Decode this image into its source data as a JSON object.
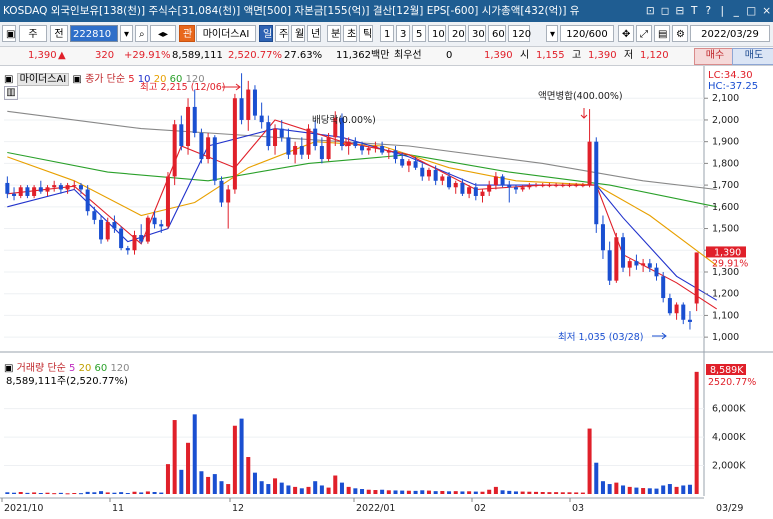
{
  "window": {
    "title": "KOSDAQ 외국인보유[138(천)] 주식수[31,084(천)] 액면[500] 자본금[155(억)] 결산[12월] EPS[-600] 시가총액[432(억)] 유",
    "controls": [
      "⊡",
      "◻",
      "⊟",
      "T",
      "?",
      "|",
      "_",
      "□",
      "×"
    ]
  },
  "toolbar": {
    "market": "주",
    "scope": "전",
    "code": "222810",
    "tag_gwan": "관",
    "stock_name": "마이더스AI",
    "period_tabs": [
      "일",
      "주",
      "월",
      "년",
      "분",
      "초",
      "틱"
    ],
    "active_period": "일",
    "minute_options": [
      "1",
      "3",
      "5",
      "10",
      "20",
      "30",
      "60",
      "120"
    ],
    "count": "120/600",
    "date": "2022/03/29"
  },
  "pricebar": {
    "price": "1,390",
    "change": "320",
    "change_pct": "+29.91%",
    "volume": "8,589,111",
    "vol_ratio": "2,520.77%",
    "turnover": "27.63%",
    "amount": "11,362백만",
    "label_pref": "최우선",
    "pref_value": "0",
    "pref_price": "1,390",
    "open_label": "시",
    "open": "1,155",
    "high_label": "고",
    "high": "1,390",
    "low_label": "저",
    "low": "1,120",
    "buy_label": "매수",
    "sell_label": "매도"
  },
  "price_panel": {
    "legend_name": "마이더스AI",
    "legend_ma": "종가 단순",
    "ma_periods": [
      "5",
      "10",
      "20",
      "60",
      "120"
    ],
    "ma_colors": [
      "#e0202a",
      "#2233cc",
      "#e8a000",
      "#2aa02a",
      "#888888"
    ],
    "lc_label": "LC:34.30",
    "hc_label": "HC:-37.25",
    "annotations": {
      "high_label": "최고 2,215 (12/06)",
      "dividend_label": "배당락(0.00%)",
      "split_label": "액면병합(400.00%)",
      "low_label": "최저 1,035 (03/28)"
    },
    "last_price_tag": "1,390",
    "last_pct_tag": "29.91%",
    "y_ticks": [
      "2,100",
      "2,000",
      "1,900",
      "1,800",
      "1,700",
      "1,600",
      "1,500",
      "1,400",
      "1,300",
      "1,200",
      "1,100",
      "1,000"
    ]
  },
  "volume_panel": {
    "legend_name": "거래량",
    "legend_ma": "단순",
    "ma_periods": [
      "5",
      "20",
      "60",
      "120"
    ],
    "value_text": "8,589,111주(2,520.77%)",
    "tag_value": "8,589K",
    "tag_pct": "2520.77%",
    "y_ticks": [
      "6,000K",
      "4,000K",
      "2,000K"
    ]
  },
  "x_axis": {
    "labels": [
      "2021/10",
      "11",
      "12",
      "2022/01",
      "02",
      "03",
      "03/29"
    ]
  },
  "colors": {
    "up": "#e0202a",
    "down": "#1a4fd1",
    "titlebar": "#1f5d92",
    "ma5": "#e0202a",
    "ma10": "#2233cc",
    "ma20": "#e8a000",
    "ma60": "#2aa02a",
    "ma120": "#888888"
  },
  "chart_data": {
    "type": "candlestick",
    "price_range": [
      950,
      2230
    ],
    "volume_range": [
      0,
      9000
    ],
    "volume_unit": "K",
    "candles": [
      [
        1710,
        1740,
        1640,
        1660
      ],
      [
        1660,
        1690,
        1630,
        1650
      ],
      [
        1650,
        1700,
        1640,
        1690
      ],
      [
        1690,
        1700,
        1640,
        1650
      ],
      [
        1650,
        1700,
        1640,
        1690
      ],
      [
        1690,
        1720,
        1660,
        1670
      ],
      [
        1670,
        1700,
        1650,
        1690
      ],
      [
        1690,
        1720,
        1670,
        1700
      ],
      [
        1700,
        1710,
        1660,
        1680
      ],
      [
        1680,
        1710,
        1660,
        1700
      ],
      [
        1700,
        1720,
        1680,
        1700
      ],
      [
        1700,
        1710,
        1660,
        1680
      ],
      [
        1680,
        1700,
        1560,
        1580
      ],
      [
        1580,
        1600,
        1520,
        1540
      ],
      [
        1540,
        1560,
        1430,
        1450
      ],
      [
        1450,
        1550,
        1440,
        1530
      ],
      [
        1530,
        1560,
        1480,
        1500
      ],
      [
        1500,
        1510,
        1400,
        1410
      ],
      [
        1410,
        1420,
        1380,
        1400
      ],
      [
        1400,
        1490,
        1380,
        1470
      ],
      [
        1470,
        1520,
        1430,
        1440
      ],
      [
        1440,
        1560,
        1430,
        1550
      ],
      [
        1550,
        1580,
        1500,
        1520
      ],
      [
        1520,
        1540,
        1480,
        1510
      ],
      [
        1510,
        1760,
        1500,
        1740
      ],
      [
        1740,
        2000,
        1700,
        1980
      ],
      [
        1980,
        2020,
        1860,
        1880
      ],
      [
        1880,
        2100,
        1840,
        2060
      ],
      [
        2060,
        2140,
        1920,
        1940
      ],
      [
        1940,
        1960,
        1800,
        1820
      ],
      [
        1820,
        1940,
        1800,
        1920
      ],
      [
        1920,
        1930,
        1700,
        1720
      ],
      [
        1720,
        1740,
        1600,
        1620
      ],
      [
        1620,
        1700,
        1500,
        1680
      ],
      [
        1680,
        2120,
        1660,
        2100
      ],
      [
        2100,
        2215,
        1980,
        2000
      ],
      [
        2000,
        2180,
        1950,
        2140
      ],
      [
        2140,
        2160,
        2000,
        2020
      ],
      [
        2020,
        2080,
        1960,
        1990
      ],
      [
        1990,
        2020,
        1860,
        1880
      ],
      [
        1880,
        1980,
        1840,
        1960
      ],
      [
        1960,
        2000,
        1900,
        1920
      ],
      [
        1920,
        1960,
        1820,
        1840
      ],
      [
        1840,
        1900,
        1800,
        1880
      ],
      [
        1880,
        1920,
        1820,
        1840
      ],
      [
        1840,
        1980,
        1820,
        1960
      ],
      [
        1960,
        2000,
        1860,
        1880
      ],
      [
        1880,
        1920,
        1800,
        1820
      ],
      [
        1820,
        1940,
        1810,
        1920
      ],
      [
        1920,
        2040,
        1880,
        2010
      ],
      [
        2010,
        2030,
        1860,
        1880
      ],
      [
        1880,
        1920,
        1840,
        1900
      ],
      [
        1900,
        1920,
        1870,
        1880
      ],
      [
        1880,
        1900,
        1840,
        1860
      ],
      [
        1860,
        1880,
        1840,
        1870
      ],
      [
        1870,
        1900,
        1850,
        1880
      ],
      [
        1880,
        1900,
        1840,
        1850
      ],
      [
        1850,
        1870,
        1820,
        1860
      ],
      [
        1860,
        1880,
        1800,
        1820
      ],
      [
        1820,
        1850,
        1780,
        1790
      ],
      [
        1790,
        1820,
        1760,
        1810
      ],
      [
        1810,
        1830,
        1770,
        1780
      ],
      [
        1780,
        1800,
        1720,
        1740
      ],
      [
        1740,
        1780,
        1720,
        1770
      ],
      [
        1770,
        1790,
        1700,
        1720
      ],
      [
        1720,
        1750,
        1700,
        1740
      ],
      [
        1740,
        1760,
        1680,
        1690
      ],
      [
        1690,
        1720,
        1660,
        1710
      ],
      [
        1710,
        1730,
        1650,
        1660
      ],
      [
        1660,
        1700,
        1640,
        1690
      ],
      [
        1690,
        1710,
        1630,
        1650
      ],
      [
        1650,
        1680,
        1620,
        1670
      ],
      [
        1670,
        1720,
        1650,
        1700
      ],
      [
        1700,
        1760,
        1680,
        1740
      ],
      [
        1740,
        1750,
        1690,
        1700
      ],
      [
        1700,
        1720,
        1620,
        1690
      ],
      [
        1690,
        1700,
        1660,
        1680
      ],
      [
        1680,
        1700,
        1670,
        1690
      ],
      [
        1690,
        1710,
        1680,
        1700
      ],
      [
        1700,
        1710,
        1690,
        1700
      ],
      [
        1700,
        1710,
        1690,
        1700
      ],
      [
        1700,
        1710,
        1690,
        1700
      ],
      [
        1700,
        1710,
        1690,
        1700
      ],
      [
        1700,
        1710,
        1690,
        1700
      ],
      [
        1700,
        1710,
        1690,
        1700
      ],
      [
        1700,
        1710,
        1690,
        1700
      ],
      [
        1700,
        1710,
        1690,
        1700
      ],
      [
        1700,
        2050,
        1690,
        1900
      ],
      [
        1900,
        1920,
        1480,
        1520
      ],
      [
        1520,
        1560,
        1360,
        1400
      ],
      [
        1400,
        1440,
        1240,
        1260
      ],
      [
        1260,
        1480,
        1250,
        1460
      ],
      [
        1460,
        1480,
        1300,
        1320
      ],
      [
        1320,
        1360,
        1280,
        1350
      ],
      [
        1350,
        1380,
        1310,
        1330
      ],
      [
        1330,
        1360,
        1300,
        1340
      ],
      [
        1340,
        1360,
        1300,
        1320
      ],
      [
        1320,
        1340,
        1260,
        1280
      ],
      [
        1280,
        1300,
        1160,
        1180
      ],
      [
        1180,
        1200,
        1100,
        1110
      ],
      [
        1110,
        1160,
        1080,
        1150
      ],
      [
        1150,
        1160,
        1060,
        1080
      ],
      [
        1080,
        1120,
        1035,
        1070
      ],
      [
        1155,
        1390,
        1120,
        1390
      ]
    ],
    "volumes": [
      120,
      90,
      140,
      80,
      110,
      70,
      90,
      60,
      80,
      50,
      70,
      60,
      150,
      120,
      200,
      110,
      90,
      130,
      70,
      160,
      110,
      180,
      140,
      100,
      2100,
      5200,
      1700,
      3600,
      5600,
      1600,
      1200,
      1400,
      900,
      700,
      4800,
      5300,
      2600,
      1500,
      900,
      700,
      1100,
      800,
      600,
      500,
      400,
      500,
      900,
      600,
      450,
      1300,
      800,
      500,
      400,
      350,
      300,
      280,
      300,
      260,
      250,
      240,
      230,
      220,
      260,
      240,
      200,
      210,
      190,
      200,
      180,
      190,
      170,
      160,
      300,
      500,
      260,
      220,
      180,
      170,
      160,
      150,
      140,
      130,
      130,
      120,
      120,
      110,
      100,
      4600,
      2200,
      900,
      700,
      800,
      600,
      500,
      450,
      420,
      400,
      380,
      600,
      700,
      500,
      600,
      650,
      8589
    ],
    "ma": {
      "ma5": [
        [
          0,
          1660
        ],
        [
          10,
          1695
        ],
        [
          20,
          1430
        ],
        [
          26,
          1880
        ],
        [
          34,
          1780
        ],
        [
          40,
          2000
        ],
        [
          50,
          1900
        ],
        [
          60,
          1840
        ],
        [
          70,
          1680
        ],
        [
          80,
          1700
        ],
        [
          88,
          1700
        ],
        [
          92,
          1380
        ],
        [
          100,
          1250
        ],
        [
          106,
          1130
        ]
      ],
      "ma10": [
        [
          0,
          1600
        ],
        [
          10,
          1680
        ],
        [
          18,
          1440
        ],
        [
          24,
          1500
        ],
        [
          30,
          1880
        ],
        [
          40,
          1960
        ],
        [
          50,
          1920
        ],
        [
          60,
          1830
        ],
        [
          70,
          1700
        ],
        [
          80,
          1700
        ],
        [
          88,
          1700
        ],
        [
          92,
          1550
        ],
        [
          100,
          1280
        ],
        [
          106,
          1170
        ]
      ],
      "ma20": [
        [
          0,
          1830
        ],
        [
          10,
          1720
        ],
        [
          20,
          1560
        ],
        [
          28,
          1620
        ],
        [
          36,
          1780
        ],
        [
          46,
          1900
        ],
        [
          56,
          1880
        ],
        [
          66,
          1780
        ],
        [
          76,
          1720
        ],
        [
          88,
          1700
        ],
        [
          96,
          1560
        ],
        [
          106,
          1330
        ]
      ],
      "ma60": [
        [
          0,
          1850
        ],
        [
          15,
          1760
        ],
        [
          30,
          1720
        ],
        [
          45,
          1800
        ],
        [
          60,
          1840
        ],
        [
          75,
          1760
        ],
        [
          90,
          1700
        ],
        [
          106,
          1600
        ]
      ],
      "ma120": [
        [
          0,
          2040
        ],
        [
          20,
          1960
        ],
        [
          40,
          1920
        ],
        [
          60,
          1880
        ],
        [
          80,
          1800
        ],
        [
          95,
          1720
        ],
        [
          106,
          1680
        ]
      ]
    }
  }
}
